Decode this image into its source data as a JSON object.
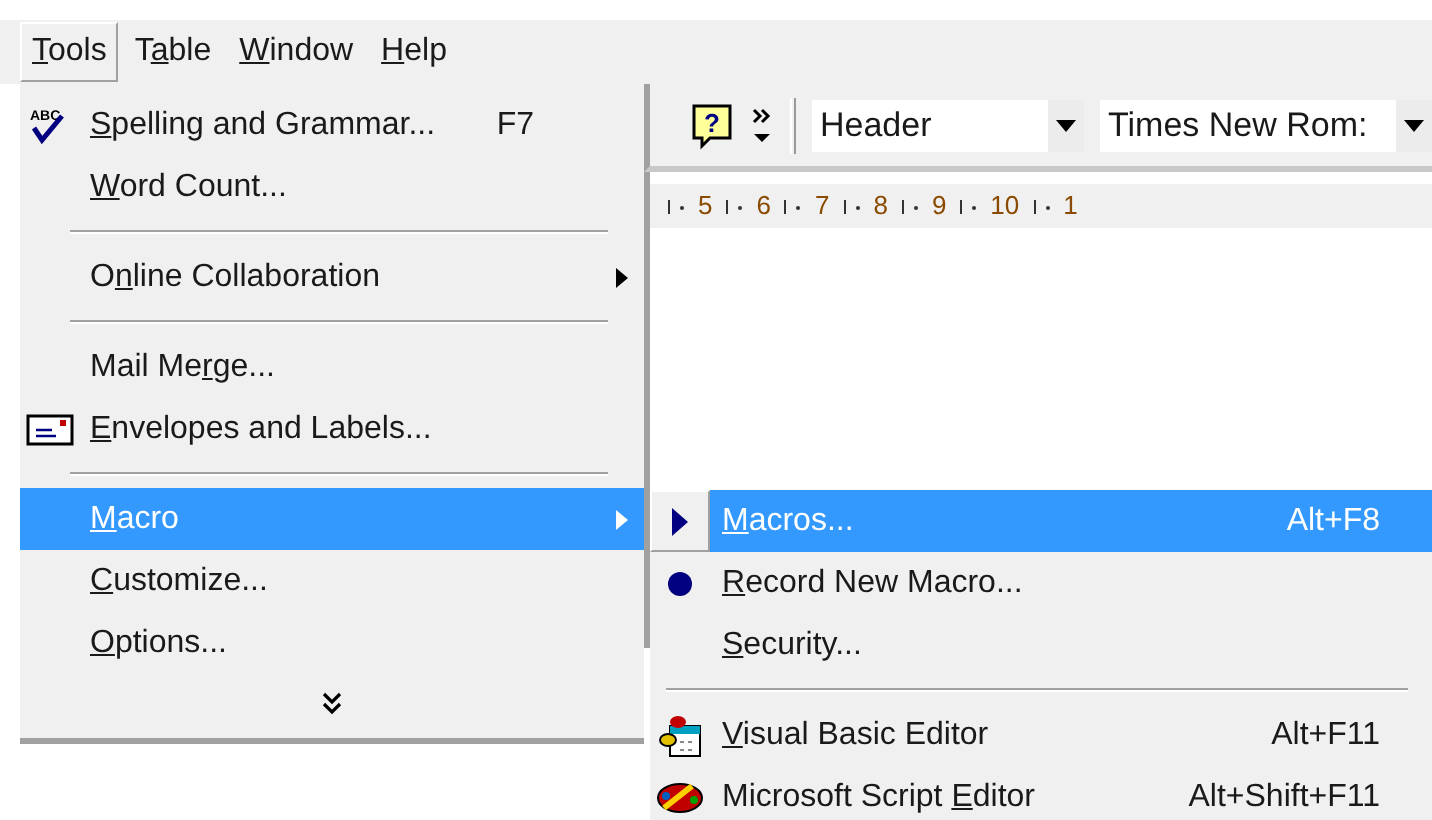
{
  "menu_bar": [
    {
      "label": {
        "key": "T",
        "post": "ools"
      },
      "selected": true
    },
    {
      "label": {
        "pre": "T",
        "key": "a",
        "post": "ble"
      },
      "selected": false
    },
    {
      "label": {
        "key": "W",
        "post": "indow"
      },
      "selected": false
    },
    {
      "label": {
        "key": "H",
        "post": "elp"
      },
      "selected": false
    }
  ],
  "toolbar": {
    "help_glyph": "?",
    "header_combo": {
      "value": "Header"
    },
    "font_combo": {
      "value": "Times New Rom:"
    }
  },
  "ruler": {
    "labels": [
      "5",
      "6",
      "7",
      "8",
      "9",
      "10",
      "1"
    ]
  },
  "tools_menu": {
    "items": [
      {
        "kind": "item",
        "icon_text": "ABC",
        "label": {
          "key": "S",
          "post": "pelling and Grammar..."
        },
        "shortcut": "F7",
        "selected": false
      },
      {
        "kind": "item",
        "label": {
          "key": "W",
          "post": "ord Count..."
        },
        "selected": false
      },
      {
        "kind": "separator"
      },
      {
        "kind": "submenu",
        "label": {
          "pre": "O",
          "key": "n",
          "post": "line Collaboration"
        },
        "selected": false
      },
      {
        "kind": "separator"
      },
      {
        "kind": "item",
        "label": {
          "pre": "Mail Me",
          "key": "r",
          "post": "ge..."
        },
        "selected": false
      },
      {
        "kind": "item",
        "label": {
          "key": "E",
          "post": "nvelopes and Labels..."
        },
        "selected": false
      },
      {
        "kind": "separator"
      },
      {
        "kind": "submenu",
        "label": {
          "key": "M",
          "post": "acro"
        },
        "selected": true
      },
      {
        "kind": "item",
        "label": {
          "key": "C",
          "post": "ustomize..."
        },
        "selected": false
      },
      {
        "kind": "item",
        "label": {
          "key": "O",
          "post": "ptions..."
        },
        "selected": false
      },
      {
        "kind": "expand"
      }
    ]
  },
  "macro_submenu": {
    "items": [
      {
        "kind": "item",
        "label": {
          "key": "M",
          "post": "acros..."
        },
        "shortcut": "Alt+F8",
        "selected": true
      },
      {
        "kind": "item",
        "label": {
          "key": "R",
          "post": "ecord New Macro..."
        },
        "selected": false
      },
      {
        "kind": "item",
        "label": {
          "key": "S",
          "post": "ecurity..."
        },
        "selected": false
      },
      {
        "kind": "separator"
      },
      {
        "kind": "item",
        "label": {
          "key": "V",
          "post": "isual Basic Editor"
        },
        "shortcut": "Alt+F11",
        "selected": false
      },
      {
        "kind": "item",
        "label": {
          "pre": "Microsoft Script ",
          "key": "E",
          "post": "ditor"
        },
        "shortcut": "Alt+Shift+F11",
        "selected": false
      }
    ]
  }
}
